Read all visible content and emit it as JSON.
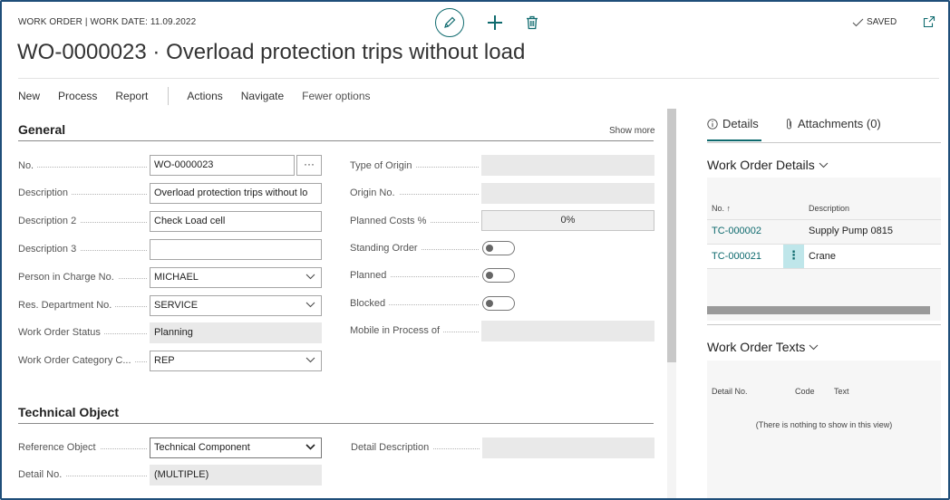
{
  "header": {
    "caption": "WORK ORDER | WORK DATE: 11.09.2022",
    "title": "WO-0000023 · Overload protection trips without load",
    "status": "SAVED",
    "icons": [
      "edit-icon",
      "plus-icon",
      "trash-icon",
      "checkmark-icon",
      "popout-icon"
    ]
  },
  "actions": {
    "new": "New",
    "process": "Process",
    "report": "Report",
    "actions": "Actions",
    "navigate": "Navigate",
    "fewer": "Fewer options"
  },
  "general": {
    "title": "General",
    "show_more": "Show more",
    "no_label": "No.",
    "no_value": "WO-0000023",
    "assist_label": "···",
    "description_label": "Description",
    "description_value": "Overload protection trips without lo",
    "description2_label": "Description 2",
    "description2_value": "Check Load cell",
    "description3_label": "Description 3",
    "description3_value": "",
    "person_label": "Person in Charge No.",
    "person_value": "MICHAEL",
    "dept_label": "Res. Department No.",
    "dept_value": "SERVICE",
    "status_label": "Work Order Status",
    "status_value": "Planning",
    "category_label": "Work Order Category C...",
    "category_value": "REP",
    "origin_type_label": "Type of Origin",
    "origin_type_value": "",
    "origin_no_label": "Origin No.",
    "origin_no_value": "",
    "planned_costs_label": "Planned Costs %",
    "planned_costs_value": "0%",
    "standing_label": "Standing Order",
    "standing_on": false,
    "planned_label": "Planned",
    "planned_on": false,
    "blocked_label": "Blocked",
    "blocked_on": false,
    "mobile_label": "Mobile in Process of",
    "mobile_value": ""
  },
  "technical": {
    "title": "Technical Object",
    "ref_label": "Reference Object",
    "ref_value": "Technical Component",
    "detail_no_label": "Detail No.",
    "detail_no_value": "(MULTIPLE)",
    "detail_desc_label": "Detail Description",
    "detail_desc_value": ""
  },
  "factbox": {
    "tab_details": "Details",
    "tab_attachments": "Attachments (0)",
    "details_part": {
      "title": "Work Order Details",
      "col_no": "No. ↑",
      "col_description": "Description",
      "rows": [
        {
          "no": "TC-000002",
          "description": "Supply Pump 0815"
        },
        {
          "no": "TC-000021",
          "description": "Crane"
        }
      ],
      "row_menu": "⋮"
    },
    "texts_part": {
      "title": "Work Order Texts",
      "col_detail_no": "Detail No.",
      "col_code": "Code",
      "col_text": "Text",
      "empty_message": "(There is nothing to show in this view)"
    }
  },
  "colors": {
    "accent": "#0e6a6e",
    "frame": "#1f4e79",
    "readonly": "#e9e9e9"
  }
}
